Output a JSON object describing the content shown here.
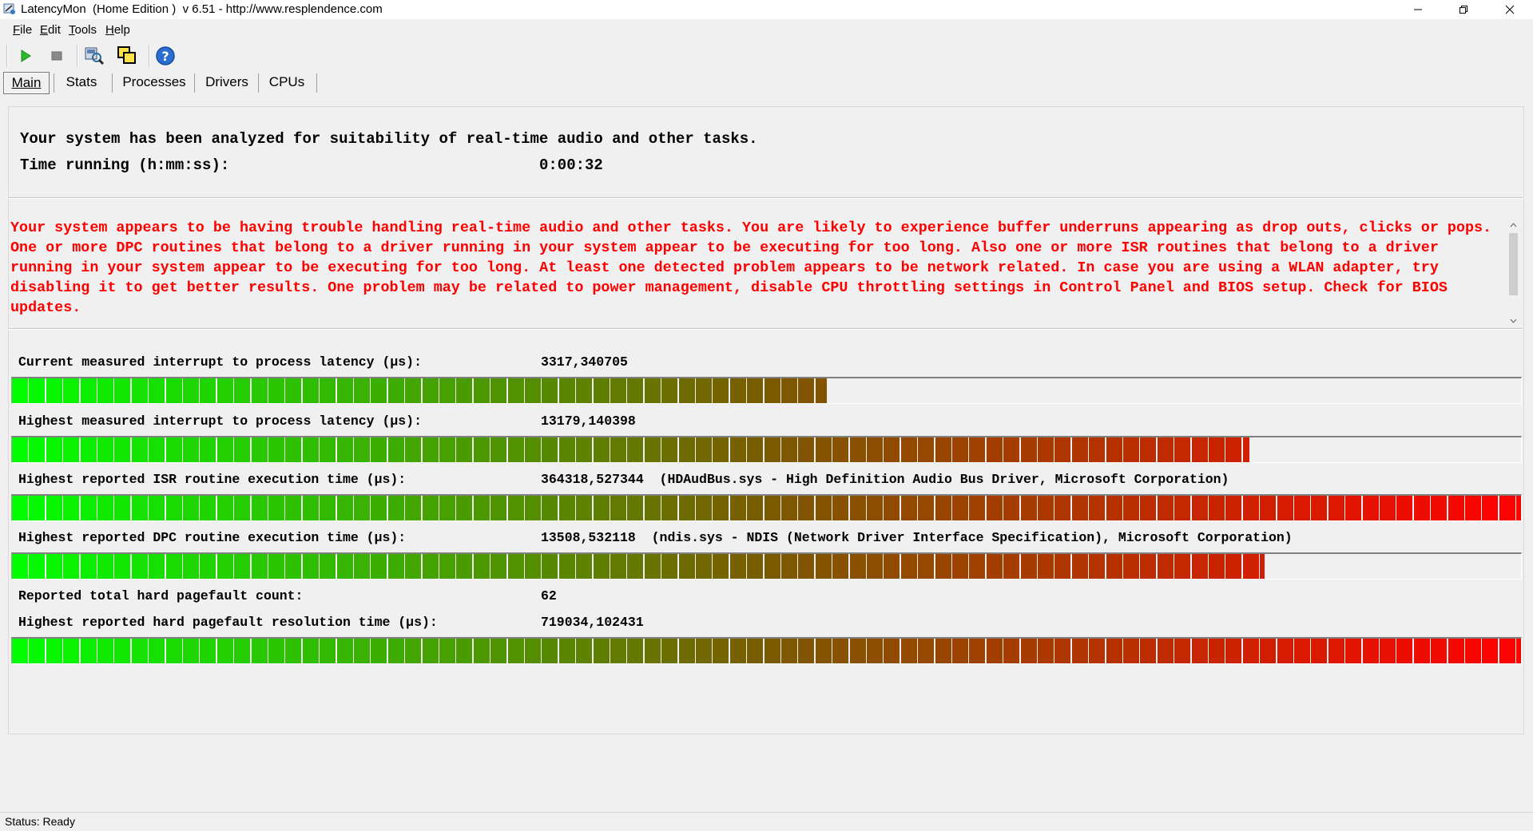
{
  "window": {
    "title": "LatencyMon  (Home Edition )  v 6.51 - http://www.resplendence.com",
    "minimize_icon": "minimize-icon",
    "maximize_icon": "restore-icon",
    "close_icon": "close-icon"
  },
  "menu": [
    {
      "key": "F",
      "rest": "ile"
    },
    {
      "key": "E",
      "rest": "dit"
    },
    {
      "key": "T",
      "rest": "ools"
    },
    {
      "key": "H",
      "rest": "elp"
    }
  ],
  "toolbar": {
    "buttons": [
      "play-icon",
      "stop-icon",
      "driver-search-icon",
      "windows-icon",
      "help-icon"
    ]
  },
  "tabs": [
    {
      "label": "Main",
      "active": true
    },
    {
      "label": "Stats",
      "active": false
    },
    {
      "label": "Processes",
      "active": false
    },
    {
      "label": "Drivers",
      "active": false
    },
    {
      "label": "CPUs",
      "active": false
    }
  ],
  "summary": {
    "analysis_line": "Your system has been analyzed for suitability of real-time audio and other tasks.",
    "time_label": "Time running (h:mm:ss):",
    "time_value": "0:00:32"
  },
  "warning": {
    "text": "Your system appears to be having trouble handling real-time audio and other tasks. You are likely to experience buffer underruns appearing as drop outs, clicks or pops. One or more DPC routines that belong to a driver running in your system appear to be executing for too long. Also one or more ISR routines that belong to a driver running in your system appear to be executing for too long. At least one detected problem appears to be network related. In case you are using a WLAN adapter, try disabling it to get better results. One problem may be related to power management, disable CPU throttling settings in Control Panel and BIOS setup. Check for BIOS updates.",
    "color": "#ff0000"
  },
  "metrics": {
    "current_latency": {
      "label": "Current measured interrupt to process latency (µs):",
      "value": "3317,340705",
      "detail": "",
      "bar_level": 0.54
    },
    "highest_latency": {
      "label": "Highest measured interrupt to process latency (µs):",
      "value": "13179,140398",
      "detail": "",
      "bar_level": 0.82
    },
    "isr_time": {
      "label": "Highest reported ISR routine execution time (µs):",
      "value": "364318,527344",
      "detail": "(HDAudBus.sys - High Definition Audio Bus Driver, Microsoft Corporation)",
      "bar_level": 1.0
    },
    "dpc_time": {
      "label": "Highest reported DPC routine execution time (µs):",
      "value": "13508,532118",
      "detail": "(ndis.sys - NDIS (Network Driver Interface Specification), Microsoft Corporation)",
      "bar_level": 0.83
    },
    "pagefault_count": {
      "label": "Reported total hard pagefault count:",
      "value": "62"
    },
    "pagefault_time": {
      "label": "Highest reported hard pagefault resolution time (µs):",
      "value": "719034,102431",
      "detail": "",
      "bar_level": 1.0
    }
  },
  "bar_colors": {
    "start": "#00ff00",
    "mid": "#7a5a00",
    "end": "#ff0000"
  },
  "status": {
    "text": "Status: Ready"
  }
}
